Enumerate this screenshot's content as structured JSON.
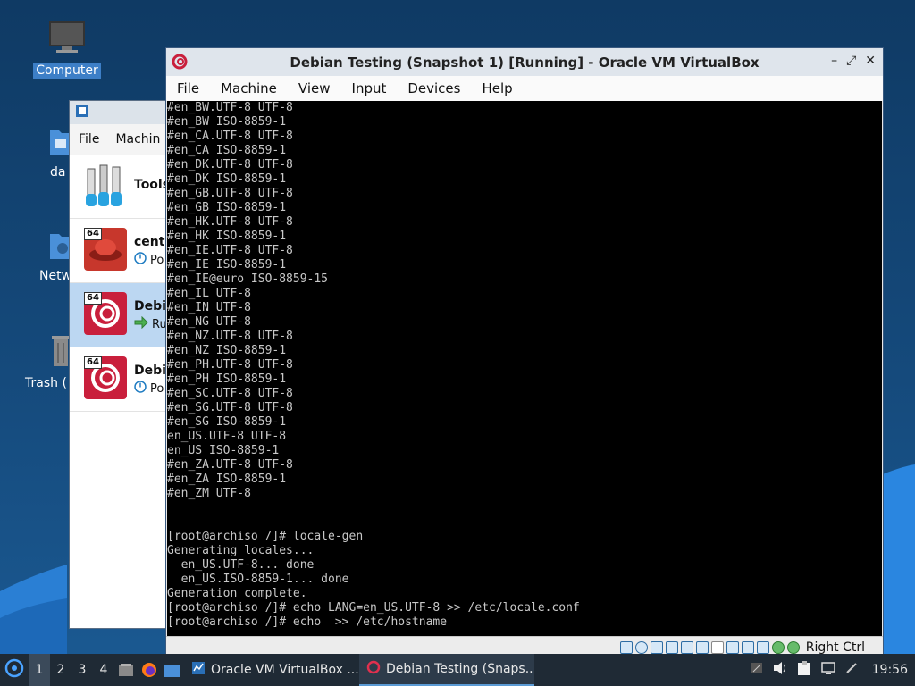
{
  "desktop": {
    "icons": [
      {
        "label": "Computer",
        "icon": "computer-icon"
      },
      {
        "label": "da",
        "icon": "home-folder-icon"
      },
      {
        "label": "Netw",
        "icon": "network-icon"
      },
      {
        "label": "Trash (",
        "icon": "trash-icon"
      }
    ]
  },
  "manager": {
    "menu": [
      "File",
      "Machin"
    ],
    "items": [
      {
        "name": "Tools",
        "state": ""
      },
      {
        "name": "cento",
        "state": "Po",
        "badge": "64"
      },
      {
        "name": "Debi",
        "state": "Ru",
        "badge": "64"
      },
      {
        "name": "Debi",
        "state": "Po",
        "badge": "64"
      }
    ]
  },
  "vm": {
    "title": "Debian Testing (Snapshot 1) [Running] - Oracle VM VirtualBox",
    "controls": [
      "–",
      "⤢",
      "✕"
    ],
    "menu": [
      "File",
      "Machine",
      "View",
      "Input",
      "Devices",
      "Help"
    ],
    "terminal_lines": [
      "#en_BW.UTF-8 UTF-8",
      "#en_BW ISO-8859-1",
      "#en_CA.UTF-8 UTF-8",
      "#en_CA ISO-8859-1",
      "#en_DK.UTF-8 UTF-8",
      "#en_DK ISO-8859-1",
      "#en_GB.UTF-8 UTF-8",
      "#en_GB ISO-8859-1",
      "#en_HK.UTF-8 UTF-8",
      "#en_HK ISO-8859-1",
      "#en_IE.UTF-8 UTF-8",
      "#en_IE ISO-8859-1",
      "#en_IE@euro ISO-8859-15",
      "#en_IL UTF-8",
      "#en_IN UTF-8",
      "#en_NG UTF-8",
      "#en_NZ.UTF-8 UTF-8",
      "#en_NZ ISO-8859-1",
      "#en_PH.UTF-8 UTF-8",
      "#en_PH ISO-8859-1",
      "#en_SC.UTF-8 UTF-8",
      "#en_SG.UTF-8 UTF-8",
      "#en_SG ISO-8859-1",
      "en_US.UTF-8 UTF-8",
      "en_US ISO-8859-1",
      "#en_ZA.UTF-8 UTF-8",
      "#en_ZA ISO-8859-1",
      "#en_ZM UTF-8",
      "",
      "",
      "[root@archiso /]# locale-gen",
      "Generating locales...",
      "  en_US.UTF-8... done",
      "  en_US.ISO-8859-1... done",
      "Generation complete.",
      "[root@archiso /]# echo LANG=en_US.UTF-8 >> /etc/locale.conf",
      "[root@archiso /]# echo  >> /etc/hostname"
    ],
    "host_key": "Right Ctrl"
  },
  "taskbar": {
    "workspaces": [
      "1",
      "2",
      "3",
      "4"
    ],
    "tasks": [
      {
        "label": "Oracle VM VirtualBox ...",
        "icon": "virtualbox-icon"
      },
      {
        "label": "Debian Testing (Snaps...",
        "icon": "debian-icon"
      }
    ],
    "clock": "19:56"
  }
}
